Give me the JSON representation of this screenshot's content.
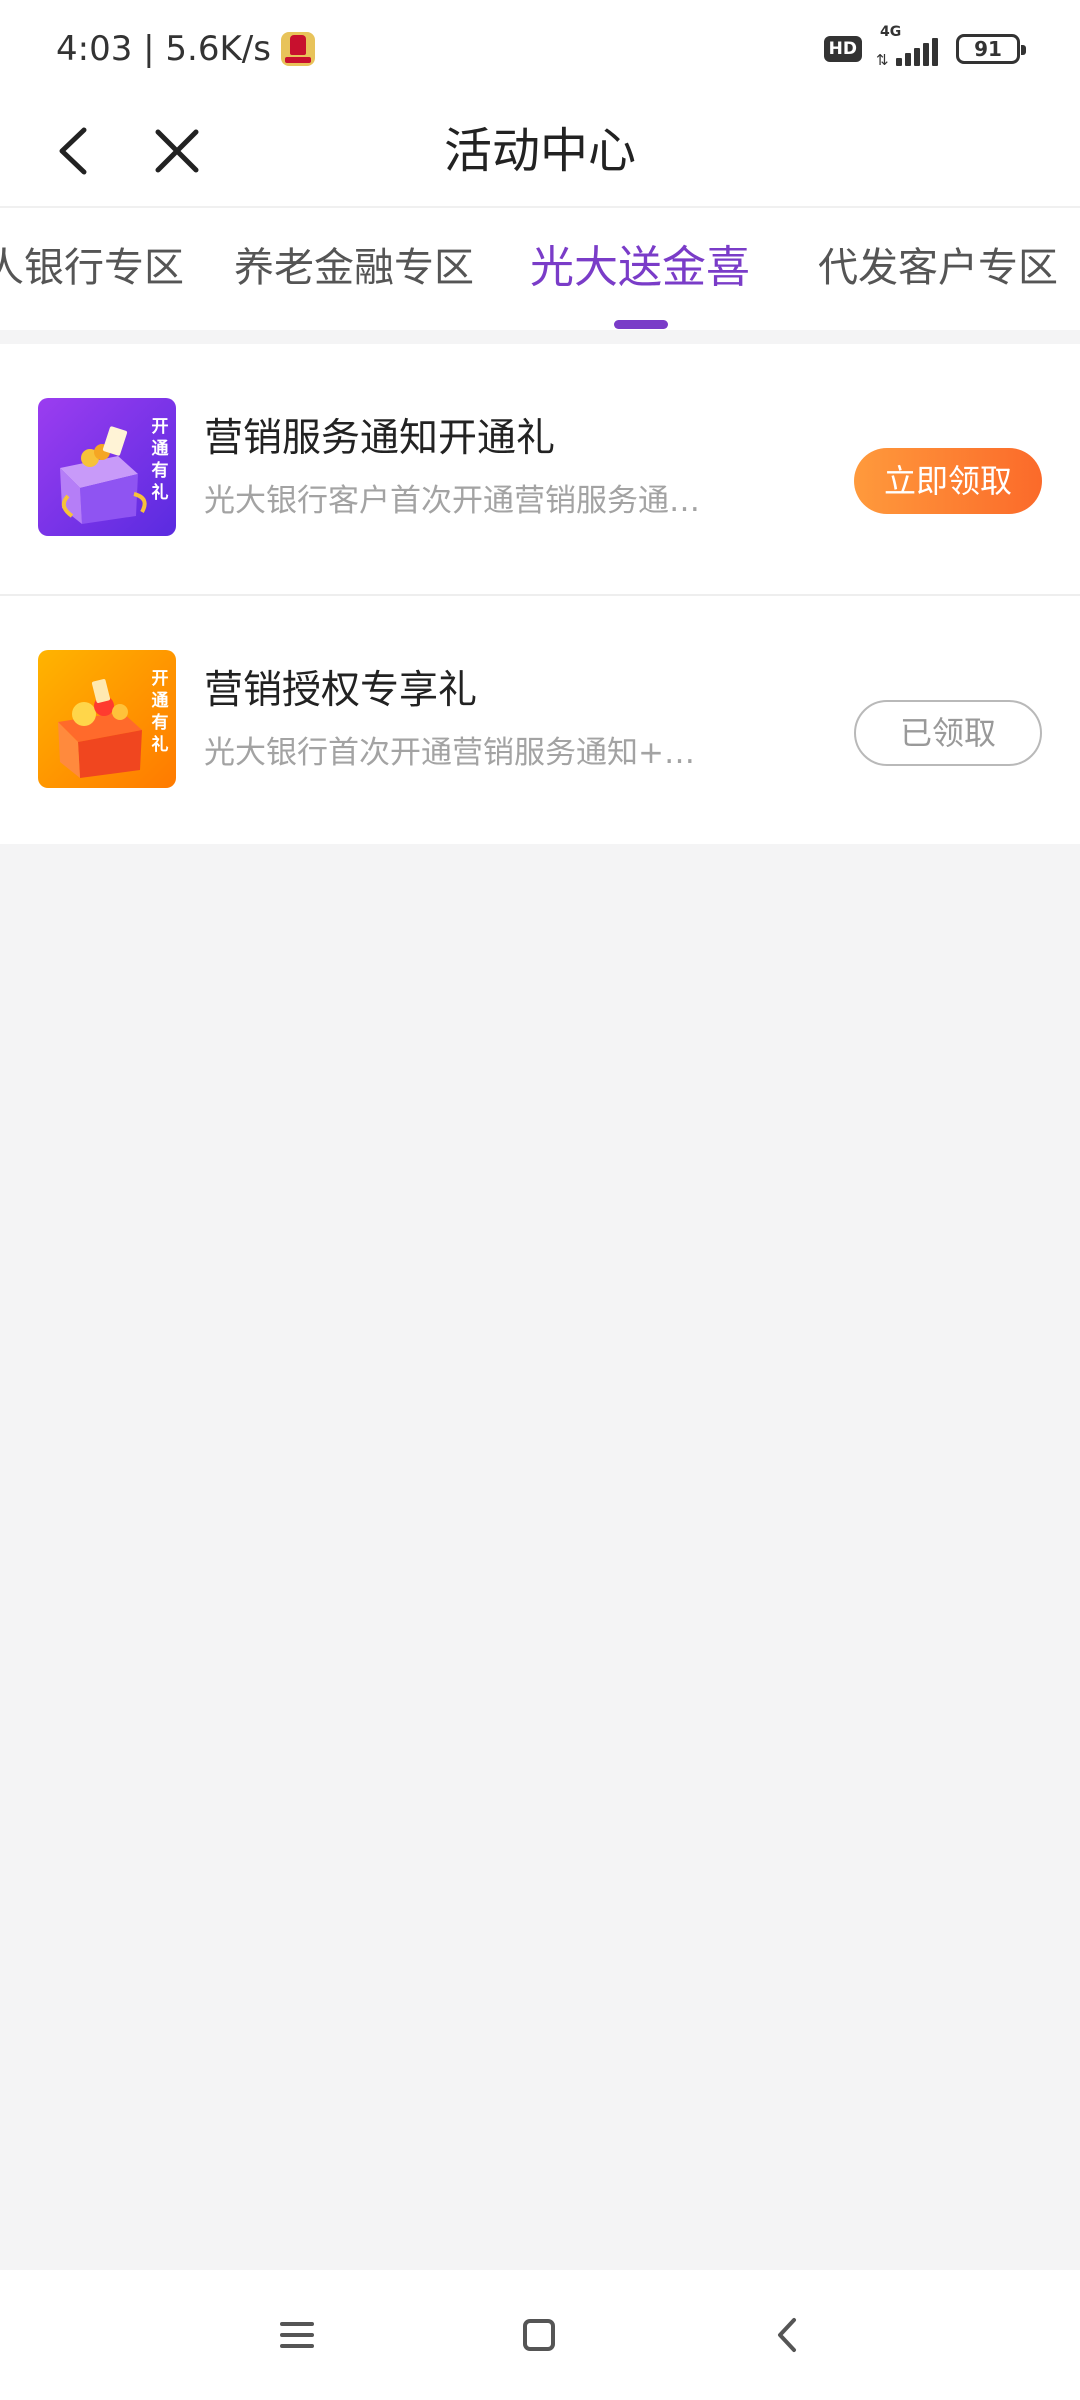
{
  "status_bar": {
    "time_speed": "4:03 | 5.6K/s",
    "hd": "HD",
    "network": "4G",
    "battery": "91"
  },
  "header": {
    "title": "活动中心"
  },
  "tabs": [
    {
      "label": "人银行专区",
      "active": false
    },
    {
      "label": "养老金融专区",
      "active": false
    },
    {
      "label": "光大送金喜",
      "active": true
    },
    {
      "label": "代发客户专区",
      "active": false
    }
  ],
  "items": [
    {
      "title": "营销服务通知开通礼",
      "desc": "光大银行客户首次开通营销服务通…",
      "badge_text": "开通有礼",
      "button": "立即领取",
      "state": "available"
    },
    {
      "title": "营销授权专享礼",
      "desc": "光大银行首次开通营销服务通知+…",
      "badge_text": "开通有礼",
      "button": "已领取",
      "state": "claimed"
    }
  ],
  "colors": {
    "accent": "#7a3cc8",
    "button_orange": "#fb6a2a",
    "background": "#f4f4f5"
  },
  "nav": {
    "icons": [
      "menu-icon",
      "home-square-icon",
      "back-chevron-icon"
    ]
  }
}
